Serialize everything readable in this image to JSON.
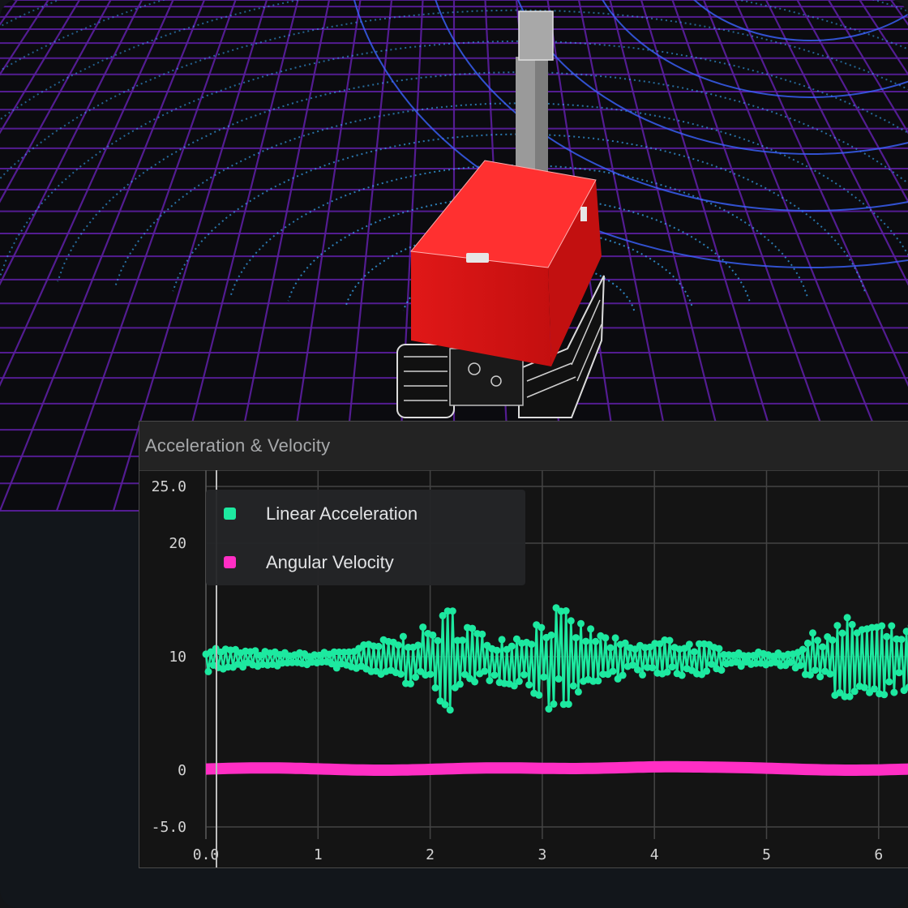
{
  "panel": {
    "title": "Acceleration & Velocity"
  },
  "scene": {
    "grid_color": "#5b1ea0",
    "pointcloud_color": "#3ab0ff",
    "robot_body_color": "#ff2a2a",
    "mast_color": "#a0a0a0"
  },
  "chart_data": {
    "type": "scatter",
    "title": "Acceleration & Velocity",
    "xlim": [
      0,
      6.3
    ],
    "ylim": [
      -5.0,
      25.0
    ],
    "x_ticks": [
      "0.0",
      "1",
      "2",
      "3",
      "4",
      "5",
      "6"
    ],
    "y_ticks": [
      {
        "value": 25,
        "label": "25.0"
      },
      {
        "value": 20,
        "label": "20"
      },
      {
        "value": 10,
        "label": "10"
      },
      {
        "value": 0,
        "label": "0"
      },
      {
        "value": -5,
        "label": "-5.0"
      }
    ],
    "grid": true,
    "legend_position": "top-left",
    "series": [
      {
        "name": "Linear Acceleration",
        "color": "#1de9a0",
        "envelope": [
          [
            0,
            1.2
          ],
          [
            0.5,
            0.7
          ],
          [
            1.0,
            0.5
          ],
          [
            1.5,
            1.5
          ],
          [
            2.0,
            3.0
          ],
          [
            2.2,
            5.0
          ],
          [
            2.5,
            2.0
          ],
          [
            2.8,
            2.5
          ],
          [
            3.1,
            5.0
          ],
          [
            3.4,
            3.0
          ],
          [
            3.8,
            1.2
          ],
          [
            4.1,
            2.0
          ],
          [
            4.4,
            1.5
          ],
          [
            4.8,
            0.6
          ],
          [
            5.2,
            0.6
          ],
          [
            5.5,
            3.0
          ],
          [
            5.8,
            4.0
          ],
          [
            6.1,
            3.0
          ],
          [
            6.3,
            3.0
          ]
        ],
        "values_mean": 9.8
      },
      {
        "name": "Angular Velocity",
        "color": "#ff2ec4",
        "values_mean": 0.1
      }
    ]
  }
}
